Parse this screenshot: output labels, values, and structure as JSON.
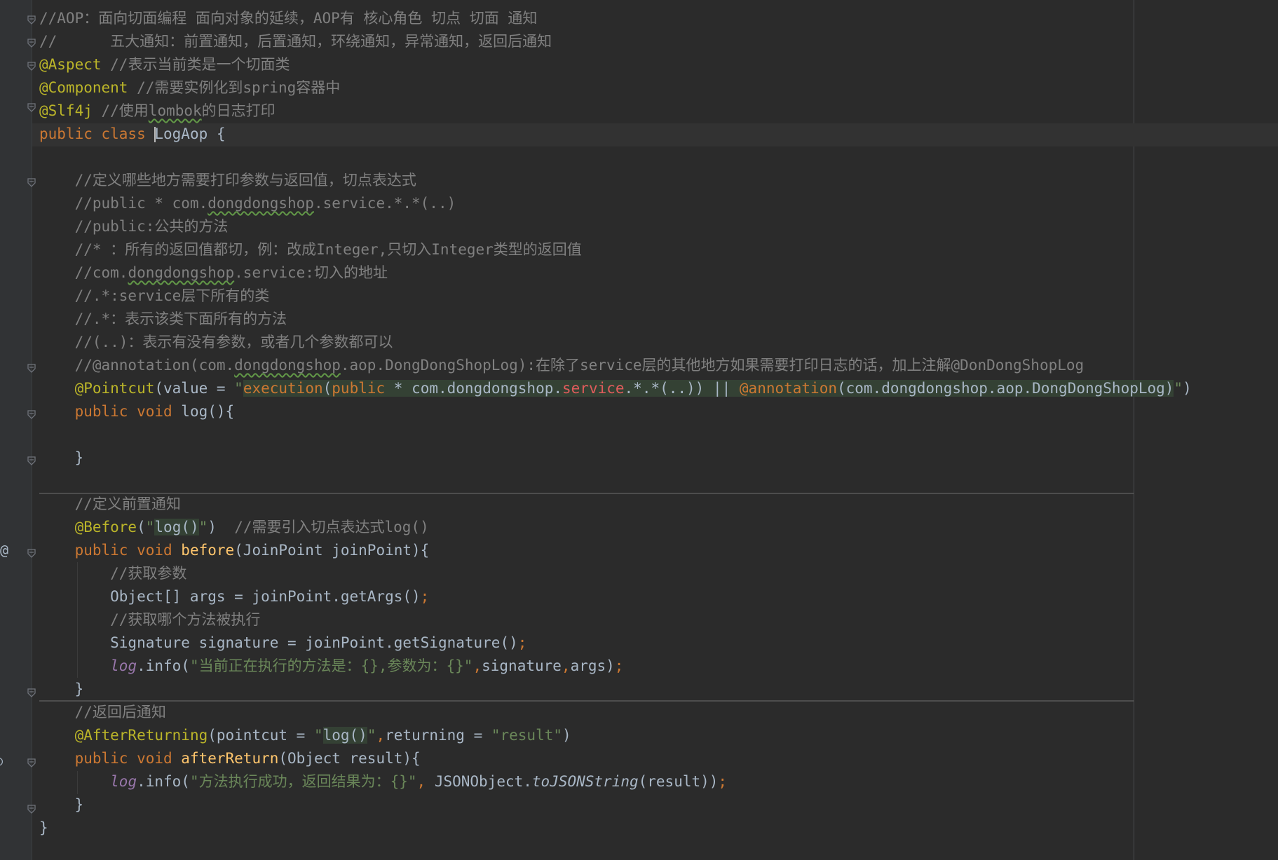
{
  "editor": {
    "colors": {
      "background": "#2b2b2b",
      "comment": "#808080",
      "keyword": "#cc7832",
      "annotation": "#bbb529",
      "string": "#6a8759",
      "method": "#ffc66d",
      "default": "#a9b7c6",
      "field": "#9876aa",
      "injected_bg": "#344134",
      "injected_keyword": "#cc7832",
      "service_red": "#e05c5c"
    },
    "gutter_markers": [
      {
        "symbol": "@"
      },
      {
        "symbol": "○"
      }
    ],
    "lines": [
      {
        "tokens": [
          {
            "t": "//AOP：面向切面编程 面向对象的延续，AOP有 核心角色 切点 切面 通知",
            "c": "comment"
          }
        ]
      },
      {
        "tokens": [
          {
            "t": "//      五大通知：前置通知，后置通知，环绕通知，异常通知，返回后通知",
            "c": "comment"
          }
        ]
      },
      {
        "tokens": [
          {
            "t": "@Aspect",
            "c": "annotation"
          },
          {
            "t": " //表示当前类是一个切面类",
            "c": "comment"
          }
        ]
      },
      {
        "tokens": [
          {
            "t": "@Component",
            "c": "annotation"
          },
          {
            "t": " //需要实例化到spring容器中",
            "c": "comment"
          }
        ]
      },
      {
        "tokens": [
          {
            "t": "@Slf4j",
            "c": "annotation"
          },
          {
            "t": " //使用",
            "c": "comment"
          },
          {
            "t": "lombok",
            "c": "comment",
            "u": true
          },
          {
            "t": "的日志打印",
            "c": "comment"
          }
        ]
      },
      {
        "tokens": [
          {
            "t": "public class ",
            "c": "keyword"
          },
          {
            "t": "LogAop",
            "c": "default",
            "caret": true
          },
          {
            "t": " {",
            "c": "default"
          }
        ]
      },
      {
        "tokens": []
      },
      {
        "tokens": [
          {
            "t": "    //定义哪些地方需要打印参数与返回值，切点表达式",
            "c": "comment"
          }
        ]
      },
      {
        "tokens": [
          {
            "t": "    //public * com.",
            "c": "comment"
          },
          {
            "t": "dongdongshop",
            "c": "comment",
            "u": true
          },
          {
            "t": ".service.*.*(..)",
            "c": "comment"
          }
        ]
      },
      {
        "tokens": [
          {
            "t": "    //public:公共的方法",
            "c": "comment"
          }
        ]
      },
      {
        "tokens": [
          {
            "t": "    //* ：所有的返回值都切，例：改成Integer,只切入Integer类型的返回值",
            "c": "comment"
          }
        ]
      },
      {
        "tokens": [
          {
            "t": "    //com.",
            "c": "comment"
          },
          {
            "t": "dongdongshop",
            "c": "comment",
            "u": true
          },
          {
            "t": ".service:切入的地址",
            "c": "comment"
          }
        ]
      },
      {
        "tokens": [
          {
            "t": "    //.*:service层下所有的类",
            "c": "comment"
          }
        ]
      },
      {
        "tokens": [
          {
            "t": "    //.*：表示该类下面所有的方法",
            "c": "comment"
          }
        ]
      },
      {
        "tokens": [
          {
            "t": "    //(..)：表示有没有参数，或者几个参数都可以",
            "c": "comment"
          }
        ]
      },
      {
        "tokens": [
          {
            "t": "    //@annotation(com.",
            "c": "comment"
          },
          {
            "t": "dongdongshop",
            "c": "comment",
            "u": true
          },
          {
            "t": ".aop.DongDongShopLog):在除了service层的其他地方如果需要打印日志的话，加上注解@DonDongShopLog",
            "c": "comment"
          }
        ]
      },
      {
        "tokens": [
          {
            "t": "    ",
            "c": "default"
          },
          {
            "t": "@Pointcut",
            "c": "annotation"
          },
          {
            "t": "(value = ",
            "c": "default"
          },
          {
            "t": "\"",
            "c": "string"
          },
          {
            "t": "execution",
            "c": "keyword",
            "bg": true
          },
          {
            "t": "(",
            "c": "default",
            "bg": true
          },
          {
            "t": "public",
            "c": "keyword",
            "bg": true
          },
          {
            "t": " * com.dongdongshop.",
            "c": "default",
            "bg": true
          },
          {
            "t": "service",
            "c": "service_red",
            "bg": true
          },
          {
            "t": ".*.*(..)) || ",
            "c": "default",
            "bg": true
          },
          {
            "t": "@annotation",
            "c": "keyword",
            "bg": true
          },
          {
            "t": "(com.dongdongshop.aop.DongDongShopLog)",
            "c": "default",
            "bg": true
          },
          {
            "t": "\"",
            "c": "string"
          },
          {
            "t": ")",
            "c": "default"
          }
        ]
      },
      {
        "tokens": [
          {
            "t": "    public void ",
            "c": "keyword"
          },
          {
            "t": "log",
            "c": "default"
          },
          {
            "t": "(){",
            "c": "default"
          }
        ]
      },
      {
        "tokens": []
      },
      {
        "tokens": [
          {
            "t": "    }",
            "c": "default"
          }
        ]
      },
      {
        "tokens": []
      },
      {
        "tokens": [
          {
            "t": "    //定义前置通知",
            "c": "comment"
          }
        ]
      },
      {
        "tokens": [
          {
            "t": "    ",
            "c": "default"
          },
          {
            "t": "@Before",
            "c": "annotation"
          },
          {
            "t": "(",
            "c": "default"
          },
          {
            "t": "\"",
            "c": "string"
          },
          {
            "t": "log()",
            "c": "default",
            "bg": true
          },
          {
            "t": "\"",
            "c": "string"
          },
          {
            "t": ")  ",
            "c": "default"
          },
          {
            "t": "//需要引入切点表达式log()",
            "c": "comment"
          }
        ]
      },
      {
        "tokens": [
          {
            "t": "    public void ",
            "c": "keyword"
          },
          {
            "t": "before",
            "c": "method"
          },
          {
            "t": "(JoinPoint joinPoint){",
            "c": "default"
          }
        ]
      },
      {
        "tokens": [
          {
            "t": "        //获取参数",
            "c": "comment"
          }
        ]
      },
      {
        "tokens": [
          {
            "t": "        Object[] args = joinPoint.getArgs()",
            "c": "default"
          },
          {
            "t": ";",
            "c": "keyword"
          }
        ]
      },
      {
        "tokens": [
          {
            "t": "        //获取哪个方法被执行",
            "c": "comment"
          }
        ]
      },
      {
        "tokens": [
          {
            "t": "        Signature signature = joinPoint.getSignature()",
            "c": "default"
          },
          {
            "t": ";",
            "c": "keyword"
          }
        ]
      },
      {
        "tokens": [
          {
            "t": "        ",
            "c": "default"
          },
          {
            "t": "log",
            "c": "field",
            "i": true
          },
          {
            "t": ".info(",
            "c": "default"
          },
          {
            "t": "\"当前正在执行的方法是：{},参数为：{}\"",
            "c": "string"
          },
          {
            "t": ",",
            "c": "keyword"
          },
          {
            "t": "signature",
            "c": "default"
          },
          {
            "t": ",",
            "c": "keyword"
          },
          {
            "t": "args)",
            "c": "default"
          },
          {
            "t": ";",
            "c": "keyword"
          }
        ]
      },
      {
        "tokens": [
          {
            "t": "    }",
            "c": "default"
          }
        ]
      },
      {
        "tokens": [
          {
            "t": "    //返回后通知",
            "c": "comment"
          }
        ]
      },
      {
        "tokens": [
          {
            "t": "    ",
            "c": "default"
          },
          {
            "t": "@AfterReturning",
            "c": "annotation"
          },
          {
            "t": "(pointcut = ",
            "c": "default"
          },
          {
            "t": "\"",
            "c": "string"
          },
          {
            "t": "log()",
            "c": "default",
            "bg": true
          },
          {
            "t": "\"",
            "c": "string"
          },
          {
            "t": ",",
            "c": "keyword"
          },
          {
            "t": "returning = ",
            "c": "default"
          },
          {
            "t": "\"result\"",
            "c": "string"
          },
          {
            "t": ")",
            "c": "default"
          }
        ]
      },
      {
        "tokens": [
          {
            "t": "    public void ",
            "c": "keyword"
          },
          {
            "t": "afterReturn",
            "c": "method"
          },
          {
            "t": "(Object result){",
            "c": "default"
          }
        ]
      },
      {
        "tokens": [
          {
            "t": "        ",
            "c": "default"
          },
          {
            "t": "log",
            "c": "field",
            "i": true
          },
          {
            "t": ".info(",
            "c": "default"
          },
          {
            "t": "\"方法执行成功，返回结果为：{}\"",
            "c": "string"
          },
          {
            "t": ", ",
            "c": "keyword"
          },
          {
            "t": "JSONObject.",
            "c": "default"
          },
          {
            "t": "toJSONString",
            "c": "default",
            "i": true
          },
          {
            "t": "(result))",
            "c": "default"
          },
          {
            "t": ";",
            "c": "keyword"
          }
        ]
      },
      {
        "tokens": [
          {
            "t": "    }",
            "c": "default"
          }
        ]
      },
      {
        "tokens": [
          {
            "t": "}",
            "c": "default"
          }
        ]
      }
    ]
  }
}
